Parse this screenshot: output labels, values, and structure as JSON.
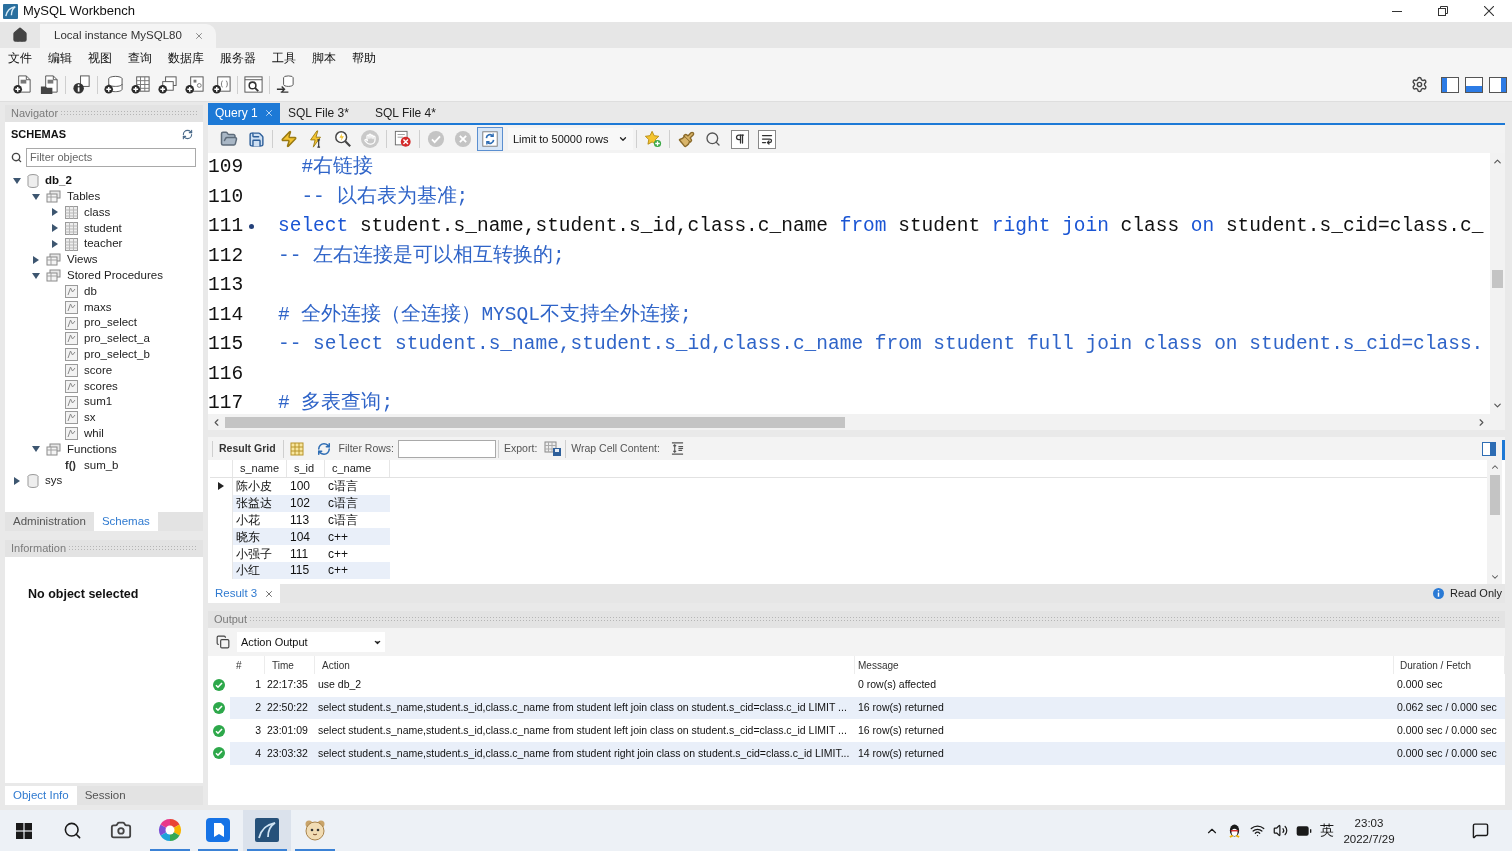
{
  "window": {
    "title": "MySQL Workbench"
  },
  "connection_tabs": [
    {
      "label": "Local instance MySQL80",
      "selected": true
    }
  ],
  "menu": [
    "文件",
    "编辑",
    "视图",
    "查询",
    "数据库",
    "服务器",
    "工具",
    "脚本",
    "帮助"
  ],
  "navigator": {
    "title": "Navigator",
    "section": "SCHEMAS",
    "filter": {
      "placeholder": "Filter objects"
    },
    "tree": [
      {
        "kind": "schema",
        "label": "db_2",
        "default": true,
        "expanded": true,
        "children": [
          {
            "kind": "folder",
            "label": "Tables",
            "expanded": true,
            "children": [
              {
                "kind": "table",
                "label": "class",
                "expanded": false
              },
              {
                "kind": "table",
                "label": "student",
                "expanded": false
              },
              {
                "kind": "table",
                "label": "teacher",
                "expanded": false
              }
            ]
          },
          {
            "kind": "folder",
            "label": "Views",
            "expanded": false
          },
          {
            "kind": "folder",
            "label": "Stored Procedures",
            "expanded": true,
            "children": [
              {
                "kind": "procedure",
                "label": "db"
              },
              {
                "kind": "procedure",
                "label": "maxs"
              },
              {
                "kind": "procedure",
                "label": "pro_select"
              },
              {
                "kind": "procedure",
                "label": "pro_select_a"
              },
              {
                "kind": "procedure",
                "label": "pro_select_b"
              },
              {
                "kind": "procedure",
                "label": "score"
              },
              {
                "kind": "procedure",
                "label": "scores"
              },
              {
                "kind": "procedure",
                "label": "sum1"
              },
              {
                "kind": "procedure",
                "label": "sx"
              },
              {
                "kind": "procedure",
                "label": "whil"
              }
            ]
          },
          {
            "kind": "folder",
            "label": "Functions",
            "expanded": true,
            "children": [
              {
                "kind": "function",
                "symbol": "f()",
                "label": "sum_b"
              }
            ]
          }
        ]
      },
      {
        "kind": "schema",
        "label": "sys",
        "default": false,
        "expanded": false
      }
    ],
    "tabs": [
      {
        "label": "Administration",
        "selected": false
      },
      {
        "label": "Schemas",
        "selected": true
      }
    ]
  },
  "information": {
    "title": "Information",
    "message": "No object selected",
    "tabs": [
      {
        "label": "Object Info",
        "selected": true
      },
      {
        "label": "Session",
        "selected": false
      }
    ]
  },
  "editor": {
    "tabs": [
      {
        "label": "Query 1",
        "selected": true
      },
      {
        "label": "SQL File 3*",
        "selected": false
      },
      {
        "label": "SQL File 4*",
        "selected": false
      }
    ],
    "toolbar": {
      "limit": "Limit to 50000 rows",
      "autocommit": true,
      "commit_enabled": false
    },
    "lines": [
      {
        "number": "109",
        "marker": false,
        "segments": [
          {
            "kind": "comment",
            "text": "  #右链接"
          }
        ]
      },
      {
        "number": "110",
        "marker": false,
        "segments": [
          {
            "kind": "comment",
            "text": "  -- 以右表为基准;"
          }
        ]
      },
      {
        "number": "111",
        "marker": true,
        "segments": [
          {
            "kind": "keyword",
            "text": "select"
          },
          {
            "kind": "plain",
            "text": " student.s_name,student.s_id,class.c_name "
          },
          {
            "kind": "keyword",
            "text": "from"
          },
          {
            "kind": "plain",
            "text": " student "
          },
          {
            "kind": "keyword",
            "text": "right join"
          },
          {
            "kind": "plain",
            "text": " class "
          },
          {
            "kind": "keyword",
            "text": "on"
          },
          {
            "kind": "plain",
            "text": " student.s_cid=class.c_"
          }
        ]
      },
      {
        "number": "112",
        "marker": false,
        "segments": [
          {
            "kind": "comment",
            "text": "-- 左右连接是可以相互转换的;"
          }
        ]
      },
      {
        "number": "113",
        "marker": false
      },
      {
        "number": "114",
        "marker": false,
        "segments": [
          {
            "kind": "comment",
            "text": "# 全外连接（全连接）MYSQL不支持全外连接;"
          }
        ]
      },
      {
        "number": "115",
        "marker": false,
        "segments": [
          {
            "kind": "comment",
            "text": "-- select student.s_name,student.s_id,class.c_name from student full join class on student.s_cid=class."
          }
        ]
      },
      {
        "number": "116",
        "marker": false
      },
      {
        "number": "117",
        "marker": false,
        "segments": [
          {
            "kind": "comment",
            "text": "# 多表查询;"
          }
        ]
      }
    ]
  },
  "result": {
    "toolbar": {
      "grid_label": "Result Grid",
      "filter_label": "Filter Rows:",
      "export_label": "Export:",
      "wrap_label": "Wrap Cell Content:"
    },
    "columns": [
      "s_name",
      "s_id",
      "c_name"
    ],
    "rows": [
      {
        "cells": [
          "陈小皮",
          "100",
          "c语言"
        ],
        "selected": true
      },
      {
        "cells": [
          "张益达",
          "102",
          "c语言"
        ],
        "selected": false
      },
      {
        "cells": [
          "小花",
          "113",
          "c语言"
        ],
        "selected": false
      },
      {
        "cells": [
          "晓东",
          "104",
          "c++"
        ],
        "selected": false
      },
      {
        "cells": [
          "小强子",
          "111",
          "c++"
        ],
        "selected": false
      },
      {
        "cells": [
          "小红",
          "115",
          "c++"
        ],
        "selected": false
      }
    ],
    "tabs": [
      {
        "label": "Result 3",
        "selected": true
      }
    ],
    "status": "Read Only"
  },
  "output": {
    "title": "Output",
    "mode": "Action Output",
    "columns": [
      "#",
      "Time",
      "Action",
      "Message",
      "Duration / Fetch"
    ],
    "rows": [
      {
        "success": true,
        "number": "1",
        "time": "22:17:35",
        "action": "use db_2",
        "message": "0 row(s) affected",
        "duration": "0.000 sec"
      },
      {
        "success": true,
        "number": "2",
        "time": "22:50:22",
        "action": "select student.s_name,student.s_id,class.c_name from student left join class on student.s_cid=class.c_id LIMIT ...",
        "message": "16 row(s) returned",
        "duration": "0.062 sec / 0.000 sec"
      },
      {
        "success": true,
        "number": "3",
        "time": "23:01:09",
        "action": "select student.s_name,student.s_id,class.c_name from student left join class on student.s_cid=class.c_id LIMIT ...",
        "message": "16 row(s) returned",
        "duration": "0.000 sec / 0.000 sec"
      },
      {
        "success": true,
        "number": "4",
        "time": "23:03:32",
        "action": "select student.s_name,student.s_id,class.c_name from student right join class on student.s_cid=class.c_id LIMIT...",
        "message": "14 row(s) returned",
        "duration": "0.000 sec / 0.000 sec"
      }
    ]
  },
  "taskbar": {
    "apps": [
      {
        "kind": "camera",
        "running": false,
        "active": false
      },
      {
        "kind": "color-wheel",
        "running": true,
        "active": false
      },
      {
        "kind": "bookmark",
        "running": true,
        "active": false
      },
      {
        "kind": "workbench",
        "running": true,
        "active": true
      },
      {
        "kind": "mascot",
        "running": true,
        "active": false
      }
    ],
    "ime": "英",
    "time": "23:03",
    "date": "2022/7/29"
  }
}
